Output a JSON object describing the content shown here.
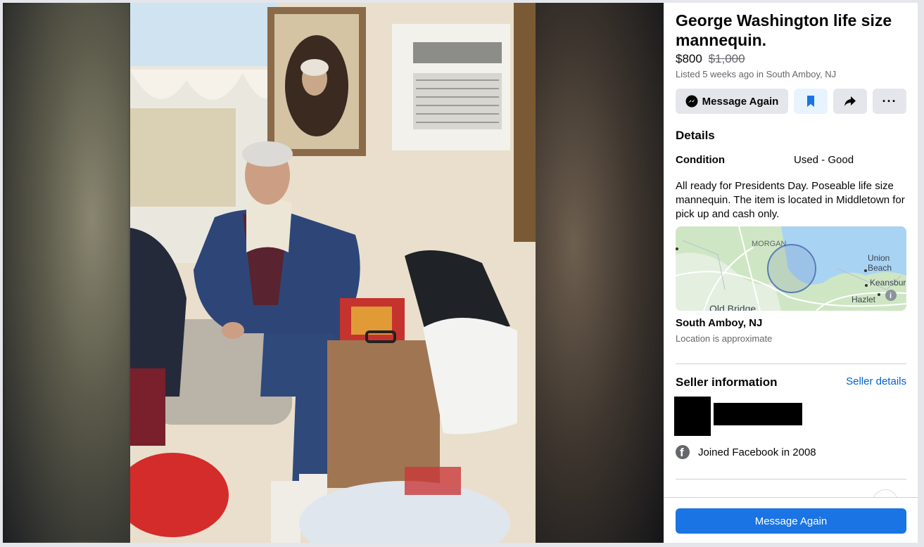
{
  "listing": {
    "title": "George Washington life size mannequin.",
    "price": "$800",
    "original_price": "$1,000",
    "listed_info": "Listed 5 weeks ago in South Amboy, NJ"
  },
  "actions": {
    "message_label": "Message Again",
    "save_icon": "bookmark-icon",
    "share_icon": "share-icon",
    "more_icon": "more-icon",
    "more_glyph": "···"
  },
  "details": {
    "heading": "Details",
    "condition_label": "Condition",
    "condition_value": "Used - Good",
    "description": "All ready for Presidents Day. Poseable life size mannequin. The item is located in Middletown for pick up and cash only."
  },
  "map": {
    "labels": {
      "morgan": "MORGAN",
      "union_beach_1": "Union",
      "union_beach_2": "Beach",
      "keansburg": "Keansbur",
      "hazlet": "Hazlet",
      "old_bridge": "Old Bridge",
      "info": "i"
    }
  },
  "location": {
    "name": "South Amboy, NJ",
    "note": "Location is approximate"
  },
  "seller": {
    "heading": "Seller information",
    "details_link": "Seller details",
    "joined": "Joined Facebook in 2008",
    "fb_glyph": "f"
  },
  "footer": {
    "primary_label": "Message Again"
  },
  "colors": {
    "primary": "#1b74e4",
    "link": "#0064d1",
    "secondary_text": "#65676b",
    "button_bg": "#e4e6eb"
  }
}
